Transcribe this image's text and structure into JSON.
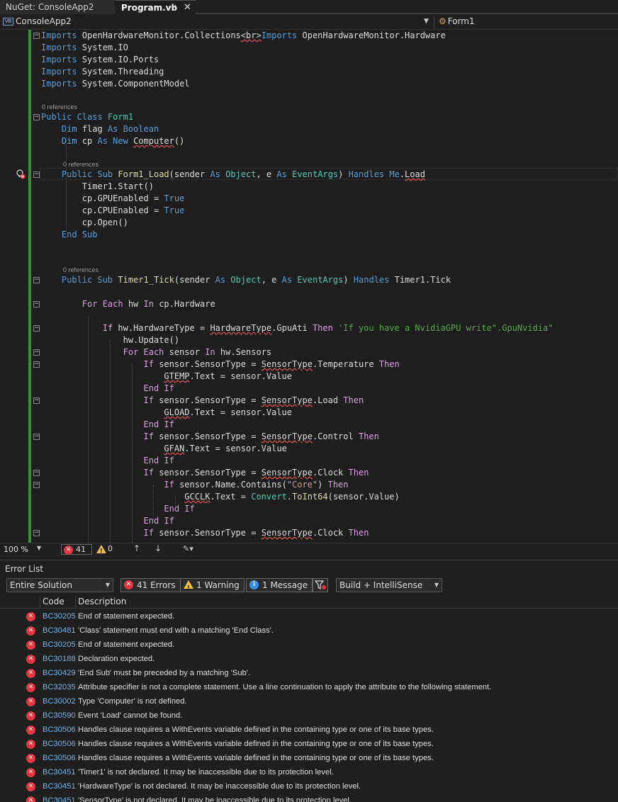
{
  "tabs": [
    {
      "label": "NuGet: ConsoleApp2"
    },
    {
      "label": "Program.vb",
      "pin": "⊣",
      "close": "✕"
    }
  ],
  "navbar": {
    "badge": "VB",
    "project": "ConsoleApp2",
    "class": "Form1"
  },
  "code": {
    "refs": [
      "0 references",
      "0 references",
      "0 references"
    ],
    "lines": [
      [
        [
          "kw",
          "Imports "
        ],
        [
          "tx",
          "OpenHardwareMonitor"
        ],
        [
          "tx",
          "."
        ],
        [
          "tx",
          "Collections"
        ],
        [
          "sq",
          "<br>"
        ],
        [
          "kw",
          "Imports "
        ],
        [
          "tx",
          "OpenHardwareMonitor"
        ],
        [
          "tx",
          "."
        ],
        [
          "tx",
          "Hardware"
        ]
      ],
      [
        [
          "kw",
          "Imports "
        ],
        [
          "tx",
          "System"
        ],
        [
          "tx",
          ".IO"
        ]
      ],
      [
        [
          "kw",
          "Imports "
        ],
        [
          "tx",
          "System.IO.Ports"
        ]
      ],
      [
        [
          "kw",
          "Imports "
        ],
        [
          "tx",
          "System"
        ],
        [
          "tx",
          ".Threading"
        ]
      ],
      [
        [
          "kw",
          "Imports "
        ],
        [
          "tx",
          "System.ComponentModel"
        ]
      ],
      [
        [
          "kw",
          "Public Class "
        ],
        [
          "ty",
          "Form1"
        ]
      ],
      [
        [
          "tx",
          "    "
        ],
        [
          "kw",
          "Dim "
        ],
        [
          "tx",
          "flag "
        ],
        [
          "kw",
          "As Boolean"
        ]
      ],
      [
        [
          "tx",
          "    "
        ],
        [
          "kw",
          "Dim "
        ],
        [
          "tx",
          "cp "
        ],
        [
          "kw",
          "As New "
        ],
        [
          "sq",
          "Computer"
        ],
        [
          "tx",
          "()"
        ]
      ],
      [
        [
          "tx",
          "    "
        ],
        [
          "kw",
          "Public Sub "
        ],
        [
          "fn",
          "Form1_Load"
        ],
        [
          "tx",
          "(sender "
        ],
        [
          "kw",
          "As "
        ],
        [
          "ty",
          "Object"
        ],
        [
          "tx",
          ", e "
        ],
        [
          "kw",
          "As "
        ],
        [
          "ty",
          "EventArgs"
        ],
        [
          "tx",
          ") "
        ],
        [
          "kw",
          "Handles Me"
        ],
        [
          "tx",
          "."
        ],
        [
          "sq",
          "Load"
        ]
      ],
      [
        [
          "tx",
          "        Timer1.Start()"
        ]
      ],
      [
        [
          "tx",
          "        cp.GPUEnabled = "
        ],
        [
          "kw",
          "True"
        ]
      ],
      [
        [
          "tx",
          "        cp.CPUEnabled = "
        ],
        [
          "kw",
          "True"
        ]
      ],
      [
        [
          "tx",
          "        cp.Open()"
        ]
      ],
      [
        [
          "tx",
          "    "
        ],
        [
          "kw",
          "End Sub"
        ]
      ],
      [
        [
          "tx",
          "    "
        ],
        [
          "kw",
          "Public Sub "
        ],
        [
          "fn",
          "Timer1_Tick"
        ],
        [
          "tx",
          "(sender "
        ],
        [
          "kw",
          "As "
        ],
        [
          "ty",
          "Object"
        ],
        [
          "tx",
          ", e "
        ],
        [
          "kw",
          "As "
        ],
        [
          "ty",
          "EventArgs"
        ],
        [
          "tx",
          ") "
        ],
        [
          "kw",
          "Handles "
        ],
        [
          "tx",
          "Timer1.Tick"
        ]
      ],
      [
        [
          "tx",
          "        "
        ],
        [
          "ctl",
          "For Each "
        ],
        [
          "tx",
          "hw "
        ],
        [
          "ctl",
          "In "
        ],
        [
          "tx",
          "cp.Hardware"
        ]
      ],
      [
        [
          "tx",
          "            "
        ],
        [
          "ctl",
          "If "
        ],
        [
          "tx",
          "hw.HardwareType = "
        ],
        [
          "sq",
          "HardwareType"
        ],
        [
          "tx",
          ".GpuAti "
        ],
        [
          "ctl",
          "Then "
        ],
        [
          "cm",
          "'If you have a NvidiaGPU write\".GpuNvidia\""
        ]
      ],
      [
        [
          "tx",
          "                hw.Update()"
        ]
      ],
      [
        [
          "tx",
          "                "
        ],
        [
          "ctl",
          "For Each "
        ],
        [
          "tx",
          "sensor "
        ],
        [
          "ctl",
          "In "
        ],
        [
          "tx",
          "hw.Sensors"
        ]
      ],
      [
        [
          "tx",
          "                    "
        ],
        [
          "ctl",
          "If "
        ],
        [
          "tx",
          "sensor.SensorType = "
        ],
        [
          "sq",
          "SensorType"
        ],
        [
          "tx",
          ".Temperature "
        ],
        [
          "ctl",
          "Then"
        ]
      ],
      [
        [
          "tx",
          "                        "
        ],
        [
          "sq",
          "GTEMP"
        ],
        [
          "tx",
          ".Text = sensor.Value"
        ]
      ],
      [
        [
          "tx",
          "                    "
        ],
        [
          "ctl",
          "End If"
        ]
      ],
      [
        [
          "tx",
          "                    "
        ],
        [
          "ctl",
          "If "
        ],
        [
          "tx",
          "sensor.SensorType = "
        ],
        [
          "sq",
          "SensorType"
        ],
        [
          "tx",
          ".Load "
        ],
        [
          "ctl",
          "Then"
        ]
      ],
      [
        [
          "tx",
          "                        "
        ],
        [
          "sq",
          "GLOAD"
        ],
        [
          "tx",
          ".Text = sensor.Value"
        ]
      ],
      [
        [
          "tx",
          "                    "
        ],
        [
          "ctl",
          "End If"
        ]
      ],
      [
        [
          "tx",
          "                    "
        ],
        [
          "ctl",
          "If "
        ],
        [
          "tx",
          "sensor.SensorType = "
        ],
        [
          "sq",
          "SensorType"
        ],
        [
          "tx",
          ".Control "
        ],
        [
          "ctl",
          "Then"
        ]
      ],
      [
        [
          "tx",
          "                        "
        ],
        [
          "sq",
          "GFAN"
        ],
        [
          "tx",
          ".Text = sensor.Value"
        ]
      ],
      [
        [
          "tx",
          "                    "
        ],
        [
          "ctl",
          "End If"
        ]
      ],
      [
        [
          "tx",
          "                    "
        ],
        [
          "ctl",
          "If "
        ],
        [
          "tx",
          "sensor.SensorType = "
        ],
        [
          "sq",
          "SensorType"
        ],
        [
          "tx",
          ".Clock "
        ],
        [
          "ctl",
          "Then"
        ]
      ],
      [
        [
          "tx",
          "                        "
        ],
        [
          "ctl",
          "If "
        ],
        [
          "tx",
          "sensor.Name.Contains("
        ],
        [
          "str",
          "\"Core\""
        ],
        [
          "tx",
          ") "
        ],
        [
          "ctl",
          "Then"
        ]
      ],
      [
        [
          "tx",
          "                            "
        ],
        [
          "sq",
          "GCCLK"
        ],
        [
          "tx",
          ".Text = "
        ],
        [
          "ty",
          "Convert"
        ],
        [
          "tx",
          "."
        ],
        [
          "fn",
          "ToInt64"
        ],
        [
          "tx",
          "(sensor.Value)"
        ]
      ],
      [
        [
          "tx",
          "                        "
        ],
        [
          "ctl",
          "End If"
        ]
      ],
      [
        [
          "tx",
          "                    "
        ],
        [
          "ctl",
          "End If"
        ]
      ],
      [
        [
          "tx",
          "                    "
        ],
        [
          "ctl",
          "If "
        ],
        [
          "tx",
          "sensor.SensorType = "
        ],
        [
          "sq",
          "SensorType"
        ],
        [
          "tx",
          ".Clock "
        ],
        [
          "ctl",
          "Then"
        ]
      ]
    ]
  },
  "status": {
    "zoom": "100 %",
    "errors": "41",
    "warnings": "0"
  },
  "error_list": {
    "title": "Error List",
    "scope": "Entire Solution",
    "errors_btn": "41 Errors",
    "warnings_btn": "1 Warning",
    "messages_btn": "1 Message",
    "build_filter": "Build + IntelliSense",
    "col_code": "Code",
    "col_desc": "Description",
    "rows": [
      {
        "code": "BC30205",
        "desc": "End of statement expected."
      },
      {
        "code": "BC30481",
        "desc": "'Class' statement must end with a matching 'End Class'."
      },
      {
        "code": "BC30205",
        "desc": "End of statement expected."
      },
      {
        "code": "BC30188",
        "desc": "Declaration expected."
      },
      {
        "code": "BC30429",
        "desc": "'End Sub' must be preceded by a matching 'Sub'."
      },
      {
        "code": "BC32035",
        "desc": "Attribute specifier is not a complete statement. Use a line continuation to apply the attribute to the following statement."
      },
      {
        "code": "BC30002",
        "desc": "Type 'Computer' is not defined."
      },
      {
        "code": "BC30590",
        "desc": "Event 'Load' cannot be found."
      },
      {
        "code": "BC30506",
        "desc": "Handles clause requires a WithEvents variable defined in the containing type or one of its base types."
      },
      {
        "code": "BC30506",
        "desc": "Handles clause requires a WithEvents variable defined in the containing type or one of its base types."
      },
      {
        "code": "BC30506",
        "desc": "Handles clause requires a WithEvents variable defined in the containing type or one of its base types."
      },
      {
        "code": "BC30451",
        "desc": "'Timer1' is not declared. It may be inaccessible due to its protection level."
      },
      {
        "code": "BC30451",
        "desc": "'HardwareType' is not declared. It may be inaccessible due to its protection level."
      },
      {
        "code": "BC30451",
        "desc": "'SensorType' is not declared. It may be inaccessible due to its protection level."
      }
    ]
  },
  "colors": {
    "error": "#e8343f",
    "warning": "#f0c040",
    "info": "#3a8ee6",
    "changebar": "#3c8c3c"
  }
}
